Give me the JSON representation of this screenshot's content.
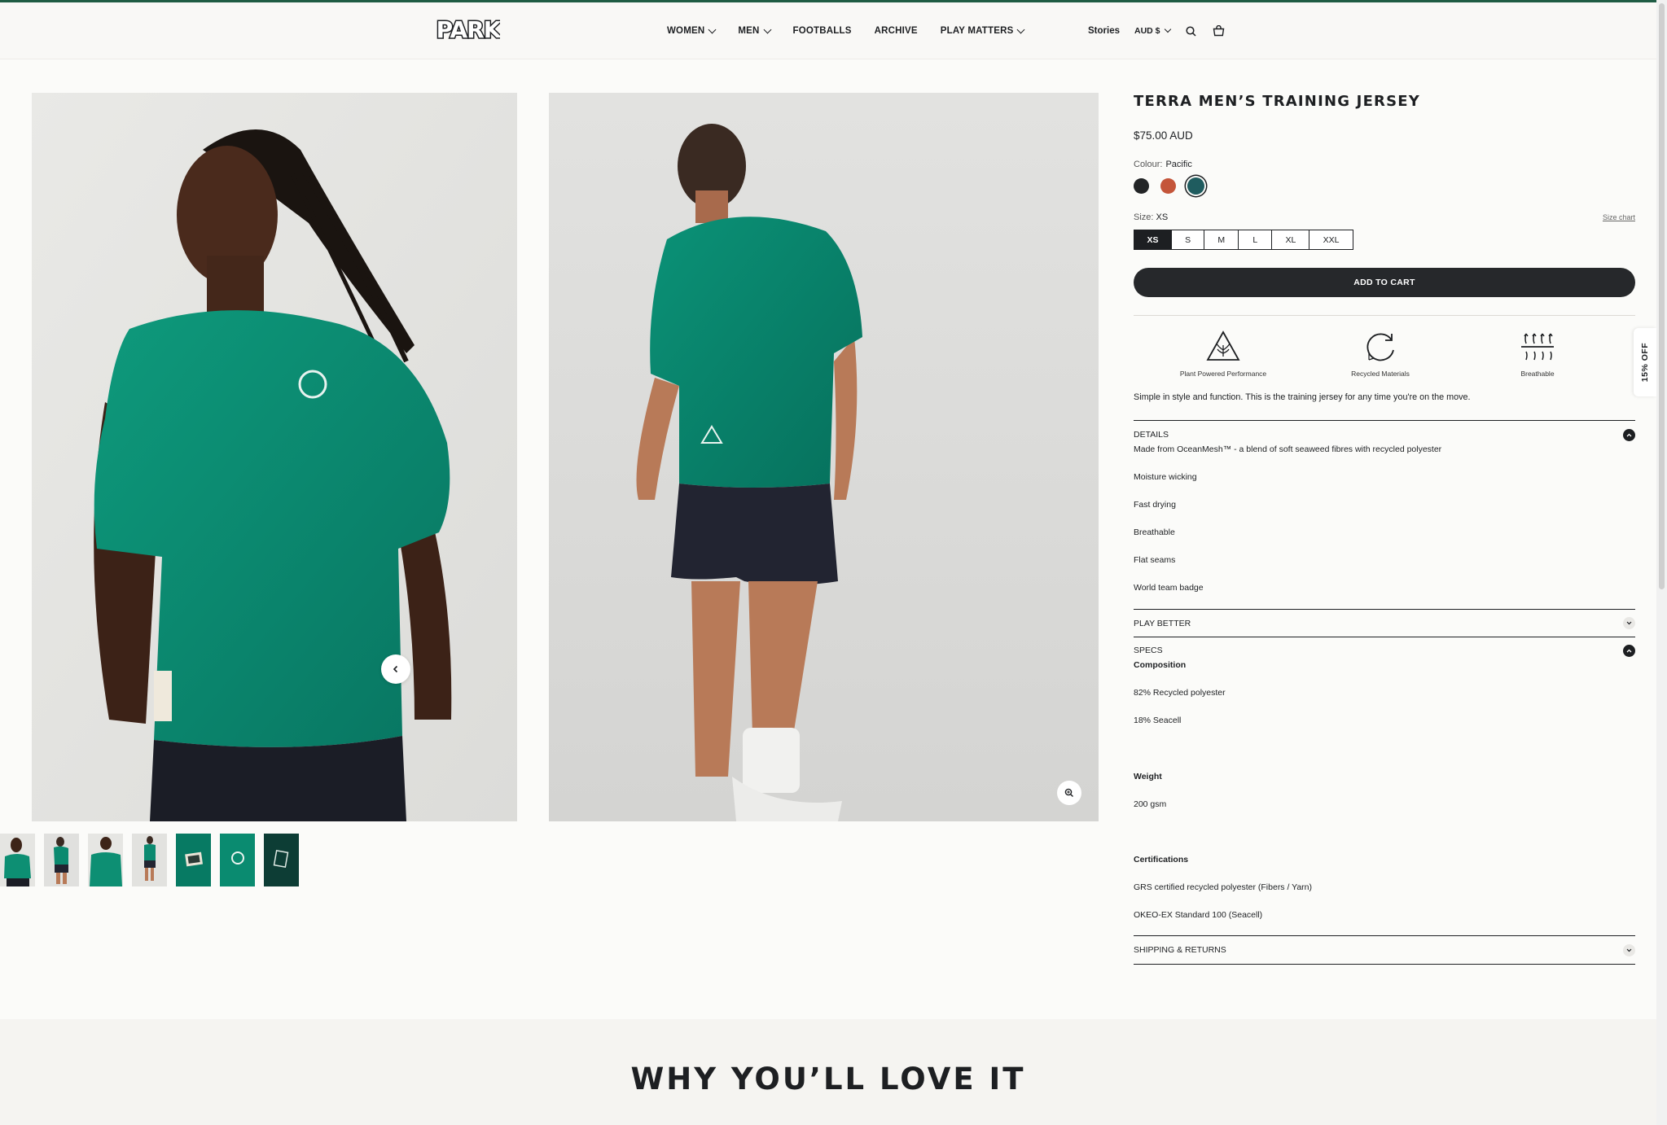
{
  "header": {
    "logo_text": "PARK",
    "nav": [
      {
        "label": "WOMEN",
        "has_dropdown": true
      },
      {
        "label": "MEN",
        "has_dropdown": true
      },
      {
        "label": "FOOTBALLS",
        "has_dropdown": false
      },
      {
        "label": "ARCHIVE",
        "has_dropdown": false
      },
      {
        "label": "PLAY MATTERS",
        "has_dropdown": true
      }
    ],
    "stories_label": "Stories",
    "currency_label": "AUD $",
    "search_icon": "search-icon",
    "cart_icon": "cart-icon"
  },
  "gallery": {
    "prev_icon": "chevron-left-icon",
    "zoom_icon": "zoom-icon",
    "thumbnail_count": 7,
    "active_thumbnail": 1
  },
  "product": {
    "title": "TERRA MEN’S TRAINING JERSEY",
    "price": "$75.00 AUD",
    "colour_label": "Colour:",
    "colour_value": "Pacific",
    "colours": [
      {
        "name": "Black",
        "hex": "#222426"
      },
      {
        "name": "Rust",
        "hex": "#c4553a"
      },
      {
        "name": "Pacific",
        "hex": "#1f5c5f"
      }
    ],
    "selected_colour": "Pacific",
    "size_label": "Size:",
    "size_value": "XS",
    "size_chart_label": "Size chart",
    "sizes": [
      "XS",
      "S",
      "M",
      "L",
      "XL",
      "XXL"
    ],
    "selected_size": "XS",
    "add_to_cart_label": "ADD TO CART",
    "features": [
      {
        "icon": "plant-triangle-icon",
        "label": "Plant Powered Performance"
      },
      {
        "icon": "recycle-icon",
        "label": "Recycled Materials"
      },
      {
        "icon": "breathable-icon",
        "label": "Breathable"
      }
    ],
    "description": "Simple in style and function. This is the training jersey for any time you're on the move."
  },
  "accordions": {
    "details": {
      "title": "DETAILS",
      "open": true,
      "lines": [
        "Made from OceanMesh™ - a blend of soft seaweed fibres with recycled polyester",
        "Moisture wicking",
        "Fast drying",
        "Breathable",
        "Flat seams",
        "World team badge"
      ]
    },
    "play_better": {
      "title": "PLAY BETTER",
      "open": false
    },
    "specs": {
      "title": "SPECS",
      "open": true,
      "composition_title": "Composition",
      "composition": [
        "82% Recycled polyester",
        "18% Seacell"
      ],
      "weight_title": "Weight",
      "weight": "200 gsm",
      "certifications_title": "Certifications",
      "certifications": [
        "GRS certified recycled polyester (Fibers / Yarn)",
        "OKEO-EX Standard 100 (Seacell)"
      ]
    },
    "shipping": {
      "title": "SHIPPING & RETURNS",
      "open": false
    }
  },
  "discount_tab": "15% OFF",
  "section_heading": "WHY YOU’LL LOVE IT",
  "colors": {
    "accent_green": "#0f8f72",
    "dark": "#1d1f22"
  }
}
